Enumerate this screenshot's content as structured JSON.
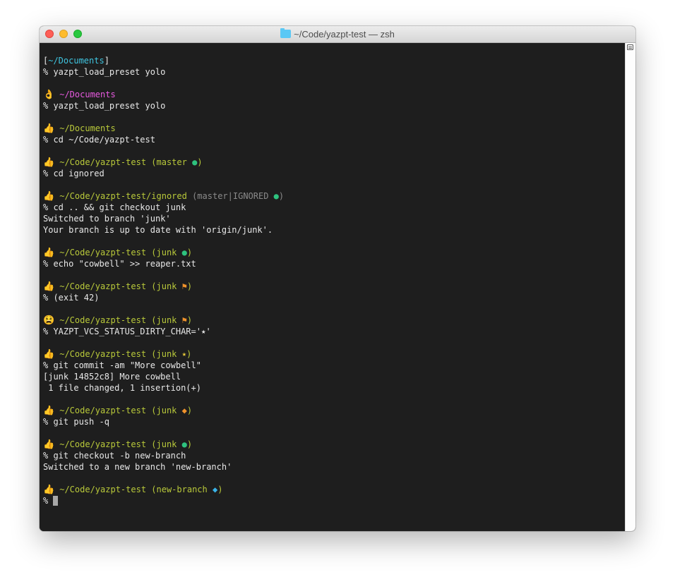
{
  "window": {
    "title": "~/Code/yazpt-test — zsh",
    "title_icon": "folder-icon"
  },
  "colors": {
    "bg": "#1e1e1e",
    "text": "#e8e8e8",
    "cyan": "#3fc5e0",
    "magenta": "#e85ae0",
    "olive": "#b9c93a",
    "gray": "#8a8a8a",
    "green": "#2ec27e",
    "orange": "#f0922b",
    "yellow": "#e8c93a",
    "blue": "#3ab4e8"
  },
  "terminal": {
    "lines": [
      [
        {
          "t": "[",
          "c": "text"
        },
        {
          "t": "~/Documents",
          "c": "cyan"
        },
        {
          "t": "]",
          "c": "text"
        }
      ],
      [
        {
          "t": "% yazpt_load_preset yolo",
          "c": "text"
        }
      ],
      [],
      [
        {
          "e": "👌"
        },
        {
          "t": " ~/Documents",
          "c": "magenta"
        }
      ],
      [
        {
          "t": "% yazpt_load_preset yolo",
          "c": "text"
        }
      ],
      [],
      [
        {
          "e": "👍"
        },
        {
          "t": " ~/Documents",
          "c": "olive"
        }
      ],
      [
        {
          "t": "% cd ~/Code/yazpt-test",
          "c": "text"
        }
      ],
      [],
      [
        {
          "e": "👍"
        },
        {
          "t": " ~/Code/yazpt-test ",
          "c": "olive"
        },
        {
          "t": "(master ",
          "c": "olive"
        },
        {
          "t": "●",
          "c": "green"
        },
        {
          "t": ")",
          "c": "olive"
        }
      ],
      [
        {
          "t": "% cd ignored",
          "c": "text"
        }
      ],
      [],
      [
        {
          "e": "👍"
        },
        {
          "t": " ~/Code/yazpt-test/ignored ",
          "c": "olive"
        },
        {
          "t": "(master|IGNORED ",
          "c": "gray"
        },
        {
          "t": "●",
          "c": "green"
        },
        {
          "t": ")",
          "c": "gray"
        }
      ],
      [
        {
          "t": "% cd .. && git checkout junk",
          "c": "text"
        }
      ],
      [
        {
          "t": "Switched to branch 'junk'",
          "c": "text"
        }
      ],
      [
        {
          "t": "Your branch is up to date with 'origin/junk'.",
          "c": "text"
        }
      ],
      [],
      [
        {
          "e": "👍"
        },
        {
          "t": " ~/Code/yazpt-test ",
          "c": "olive"
        },
        {
          "t": "(junk ",
          "c": "olive"
        },
        {
          "t": "●",
          "c": "green"
        },
        {
          "t": ")",
          "c": "olive"
        }
      ],
      [
        {
          "t": "% echo \"cowbell\" >> reaper.txt",
          "c": "text"
        }
      ],
      [],
      [
        {
          "e": "👍"
        },
        {
          "t": " ~/Code/yazpt-test ",
          "c": "olive"
        },
        {
          "t": "(junk ",
          "c": "olive"
        },
        {
          "t": "⚑",
          "c": "orange"
        },
        {
          "t": ")",
          "c": "olive"
        }
      ],
      [
        {
          "t": "% (exit 42)",
          "c": "text"
        }
      ],
      [],
      [
        {
          "e": "😫"
        },
        {
          "t": " ~/Code/yazpt-test ",
          "c": "olive"
        },
        {
          "t": "(junk ",
          "c": "olive"
        },
        {
          "t": "⚑",
          "c": "orange"
        },
        {
          "t": ")",
          "c": "olive"
        }
      ],
      [
        {
          "t": "% YAZPT_VCS_STATUS_DIRTY_CHAR='⭑'",
          "c": "text"
        }
      ],
      [],
      [
        {
          "e": "👍"
        },
        {
          "t": " ~/Code/yazpt-test ",
          "c": "olive"
        },
        {
          "t": "(junk ",
          "c": "olive"
        },
        {
          "t": "⭑",
          "c": "yellow"
        },
        {
          "t": ")",
          "c": "olive"
        }
      ],
      [
        {
          "t": "% git commit -am \"More cowbell\"",
          "c": "text"
        }
      ],
      [
        {
          "t": "[junk 14852c8] More cowbell",
          "c": "text"
        }
      ],
      [
        {
          "t": " 1 file changed, 1 insertion(+)",
          "c": "text"
        }
      ],
      [],
      [
        {
          "e": "👍"
        },
        {
          "t": " ~/Code/yazpt-test ",
          "c": "olive"
        },
        {
          "t": "(junk ",
          "c": "olive"
        },
        {
          "t": "◆",
          "c": "orange"
        },
        {
          "t": ")",
          "c": "olive"
        }
      ],
      [
        {
          "t": "% git push -q",
          "c": "text"
        }
      ],
      [],
      [
        {
          "e": "👍"
        },
        {
          "t": " ~/Code/yazpt-test ",
          "c": "olive"
        },
        {
          "t": "(junk ",
          "c": "olive"
        },
        {
          "t": "●",
          "c": "green"
        },
        {
          "t": ")",
          "c": "olive"
        }
      ],
      [
        {
          "t": "% git checkout -b new-branch",
          "c": "text"
        }
      ],
      [
        {
          "t": "Switched to a new branch 'new-branch'",
          "c": "text"
        }
      ],
      [],
      [
        {
          "e": "👍"
        },
        {
          "t": " ~/Code/yazpt-test ",
          "c": "olive"
        },
        {
          "t": "(new-branch ",
          "c": "olive"
        },
        {
          "t": "◆",
          "c": "blue"
        },
        {
          "t": ")",
          "c": "olive"
        }
      ],
      [
        {
          "t": "% ",
          "c": "text"
        },
        {
          "cursor": true
        }
      ]
    ]
  }
}
